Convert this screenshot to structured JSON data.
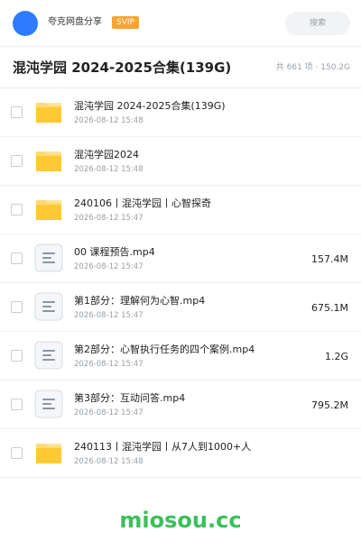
{
  "topbar": {
    "user_name": "夸克网盘分享",
    "badge": "SVIP",
    "search_placeholder": "搜索"
  },
  "header": {
    "title": "混沌学园 2024-2025合集(139G)",
    "summary": "共 661 项 · 150.2G"
  },
  "files": [
    {
      "name": "混沌学园 2024-2025合集(139G)",
      "date": "2026-08-12 15:48",
      "size": "",
      "icon": "folder-icon"
    },
    {
      "name": "混沌学园2024",
      "date": "2026-08-12 15:48",
      "size": "",
      "icon": "folder-icon"
    },
    {
      "name": "240106丨混沌学园丨心智探奇",
      "date": "2026-08-12 15:47",
      "size": "",
      "icon": "folder-icon"
    },
    {
      "name": "00 课程预告.mp4",
      "date": "2026-08-12 15:47",
      "size": "157.4M",
      "icon": "video-file-icon"
    },
    {
      "name": "第1部分：理解何为心智.mp4",
      "date": "2026-08-12 15:47",
      "size": "675.1M",
      "icon": "video-file-icon"
    },
    {
      "name": "第2部分：心智执行任务的四个案例.mp4",
      "date": "2026-08-12 15:47",
      "size": "1.2G",
      "icon": "video-file-icon"
    },
    {
      "name": "第3部分：互动问答.mp4",
      "date": "2026-08-12 15:47",
      "size": "795.2M",
      "icon": "video-file-icon"
    },
    {
      "name": "240113丨混沌学园丨从7人到1000+人",
      "date": "2026-08-12 15:48",
      "size": "",
      "icon": "folder-icon"
    }
  ],
  "watermark": "miosou.cc",
  "colors": {
    "avatar": "#2f7bff",
    "svip_badge": "#f7a333",
    "folder": "#ffc933",
    "watermark": "#3cbf5c"
  }
}
